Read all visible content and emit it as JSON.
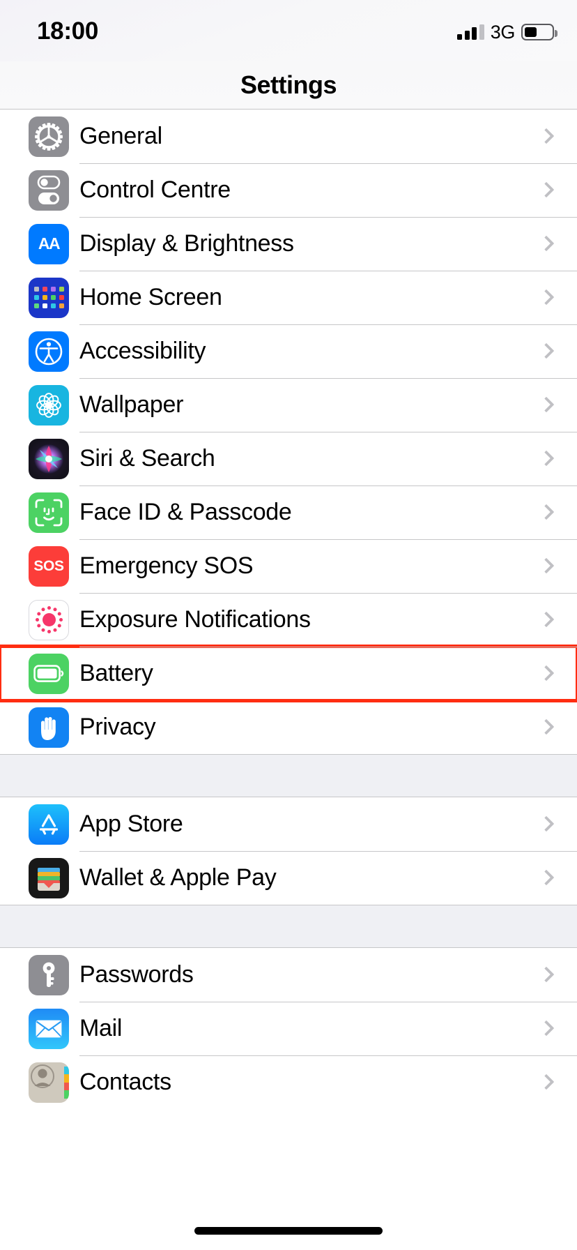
{
  "status_bar": {
    "time": "18:00",
    "network": "3G",
    "signal_icon": "cellular-bars-icon",
    "signal_bars_filled": 3,
    "signal_bars_total": 4,
    "battery_icon": "battery-icon",
    "battery_level_percent": 45
  },
  "nav": {
    "title": "Settings"
  },
  "colors": {
    "highlight": "#ff2d11",
    "accent_blue": "#007aff",
    "row_background": "#ffffff",
    "group_gap": "#eff0f4",
    "separator": "#c6c6c8",
    "chevron": "#c0c0c4"
  },
  "groups": [
    {
      "id": "system-group",
      "rows": [
        {
          "label": "General",
          "icon": "gear-icon",
          "icon_class": "ic-gear",
          "chevron": "chevron-right-icon",
          "highlighted": false
        },
        {
          "label": "Control Centre",
          "icon": "control-centre-icon",
          "icon_class": "ic-cc",
          "chevron": "chevron-right-icon",
          "highlighted": false
        },
        {
          "label": "Display & Brightness",
          "icon": "display-brightness-icon",
          "icon_class": "ic-display",
          "chevron": "chevron-right-icon",
          "highlighted": false
        },
        {
          "label": "Home Screen",
          "icon": "home-screen-icon",
          "icon_class": "ic-home",
          "chevron": "chevron-right-icon",
          "highlighted": false
        },
        {
          "label": "Accessibility",
          "icon": "accessibility-icon",
          "icon_class": "ic-access",
          "chevron": "chevron-right-icon",
          "highlighted": false
        },
        {
          "label": "Wallpaper",
          "icon": "wallpaper-icon",
          "icon_class": "ic-wall",
          "chevron": "chevron-right-icon",
          "highlighted": false
        },
        {
          "label": "Siri & Search",
          "icon": "siri-icon",
          "icon_class": "ic-siri",
          "chevron": "chevron-right-icon",
          "highlighted": false
        },
        {
          "label": "Face ID & Passcode",
          "icon": "face-id-icon",
          "icon_class": "ic-faceid",
          "chevron": "chevron-right-icon",
          "highlighted": false
        },
        {
          "label": "Emergency SOS",
          "icon": "emergency-sos-icon",
          "icon_class": "ic-sos",
          "icon_text": "SOS",
          "chevron": "chevron-right-icon",
          "highlighted": false
        },
        {
          "label": "Exposure Notifications",
          "icon": "exposure-notifications-icon",
          "icon_class": "ic-exposure",
          "chevron": "chevron-right-icon",
          "highlighted": false
        },
        {
          "label": "Battery",
          "icon": "battery-settings-icon",
          "icon_class": "ic-battery",
          "chevron": "chevron-right-icon",
          "highlighted": true
        },
        {
          "label": "Privacy",
          "icon": "privacy-hand-icon",
          "icon_class": "ic-privacy",
          "chevron": "chevron-right-icon",
          "highlighted": false
        }
      ]
    },
    {
      "id": "store-group",
      "rows": [
        {
          "label": "App Store",
          "icon": "app-store-icon",
          "icon_class": "ic-appstore",
          "chevron": "chevron-right-icon",
          "highlighted": false
        },
        {
          "label": "Wallet & Apple Pay",
          "icon": "wallet-icon",
          "icon_class": "ic-wallet",
          "chevron": "chevron-right-icon",
          "highlighted": false
        }
      ]
    },
    {
      "id": "accounts-group",
      "rows": [
        {
          "label": "Passwords",
          "icon": "key-icon",
          "icon_class": "ic-passwords",
          "chevron": "chevron-right-icon",
          "highlighted": false
        },
        {
          "label": "Mail",
          "icon": "mail-envelope-icon",
          "icon_class": "ic-mail",
          "chevron": "chevron-right-icon",
          "highlighted": false
        },
        {
          "label": "Contacts",
          "icon": "contacts-icon",
          "icon_class": "ic-contacts",
          "chevron": "chevron-right-icon",
          "highlighted": false
        }
      ]
    }
  ],
  "home_indicator": "home-indicator"
}
